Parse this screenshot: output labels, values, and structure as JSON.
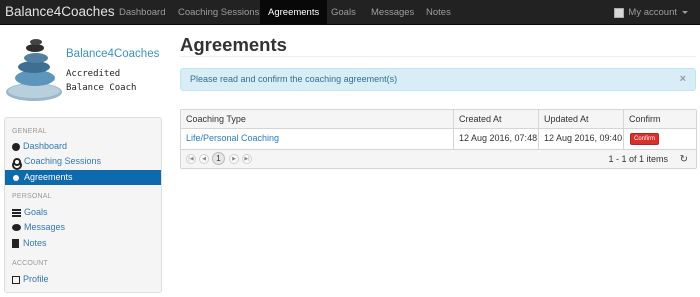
{
  "navbar": {
    "brand": "Balance4Coaches",
    "links": [
      "Dashboard",
      "Coaching Sessions",
      "Agreements",
      "Goals",
      "Messages",
      "Notes"
    ],
    "active": "Agreements",
    "account": "My account"
  },
  "logo": {
    "name": "Balance4Coaches",
    "subtitle": "Accredited\nBalance Coach"
  },
  "sidebar": {
    "sections": [
      {
        "header": "GENERAL",
        "items": [
          {
            "label": "Dashboard",
            "icon": "tachometer-icon"
          },
          {
            "label": "Coaching Sessions",
            "icon": "cogs-icon"
          },
          {
            "label": "Agreements",
            "icon": "circle-icon",
            "active": true
          }
        ]
      },
      {
        "header": "PERSONAL",
        "items": [
          {
            "label": "Goals",
            "icon": "list-icon"
          },
          {
            "label": "Messages",
            "icon": "comments-icon"
          },
          {
            "label": "Notes",
            "icon": "file-icon"
          }
        ]
      },
      {
        "header": "ACCOUNT",
        "items": [
          {
            "label": "Profile",
            "icon": "edit-icon"
          }
        ]
      }
    ]
  },
  "main": {
    "title": "Agreements",
    "alert": {
      "text": "Please read and confirm the coaching agreement(s)",
      "close": "×"
    },
    "table": {
      "columns": [
        "Coaching Type",
        "Created At",
        "Updated At",
        "Confirm"
      ],
      "rows": [
        {
          "type": "Life/Personal Coaching",
          "created": "12 Aug 2016, 07:48",
          "updated": "12 Aug 2016, 09:40",
          "action": "Confirm"
        }
      ],
      "pager": {
        "current": "1",
        "info": "1 - 1 of 1 items"
      }
    }
  },
  "colors": {
    "navbar": "#222222",
    "active_item": "#0d6aad",
    "link": "#2a7ec0",
    "alert_bg": "#d9edf7",
    "danger": "#d9302c"
  }
}
